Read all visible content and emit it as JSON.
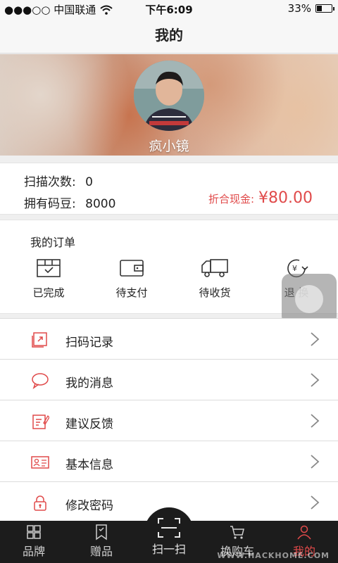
{
  "status_bar": {
    "carrier": "●●●○○ 中国联通",
    "time": "下午6:09",
    "battery_text": "33%",
    "battery_level": 0.33
  },
  "nav": {
    "title": "我的"
  },
  "profile": {
    "username": "疯小镜"
  },
  "stats": {
    "scan_label": "扫描次数:",
    "scan_value": "0",
    "beans_label": "拥有码豆:",
    "beans_value": "8000",
    "cash_label": "折合现金:",
    "cash_value": "¥80.00"
  },
  "orders": {
    "title": "我的订单",
    "items": [
      {
        "label": "已完成",
        "icon": "completed-box-icon"
      },
      {
        "label": "待支付",
        "icon": "wallet-icon"
      },
      {
        "label": "待收货",
        "icon": "truck-icon"
      },
      {
        "label": "退 换",
        "icon": "refund-icon"
      }
    ]
  },
  "menu": [
    {
      "label": "扫码记录",
      "icon": "scan-record-icon"
    },
    {
      "label": "我的消息",
      "icon": "message-bubble-icon"
    },
    {
      "label": "建议反馈",
      "icon": "feedback-icon"
    },
    {
      "label": "基本信息",
      "icon": "id-card-icon"
    },
    {
      "label": "修改密码",
      "icon": "lock-icon"
    }
  ],
  "tabs": [
    {
      "label": "品牌",
      "icon": "grid-icon"
    },
    {
      "label": "赠品",
      "icon": "bookmark-icon"
    },
    {
      "label": "扫一扫",
      "icon": "scan-frame-icon"
    },
    {
      "label": "换购车",
      "icon": "cart-icon"
    },
    {
      "label": "我的",
      "icon": "profile-icon"
    }
  ],
  "active_tab": "我的",
  "watermark": "WWW.HACKHOME.COM",
  "colors": {
    "accent": "#e04a4a",
    "tab_bg": "#1c1c1c",
    "page_bg": "#efefef"
  }
}
